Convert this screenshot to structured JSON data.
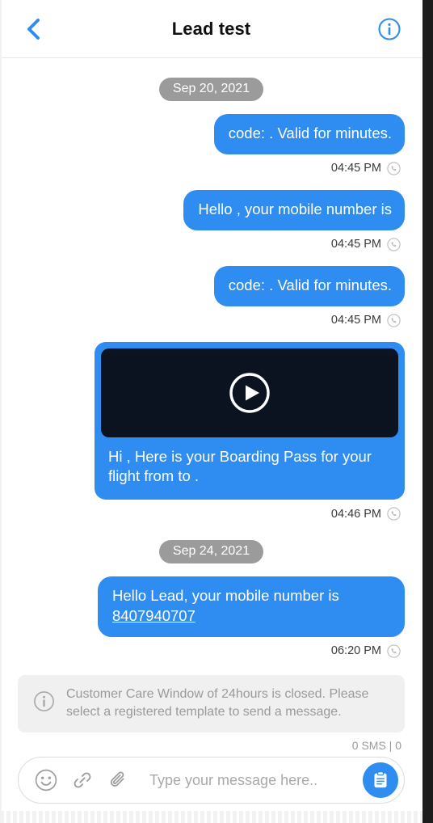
{
  "header": {
    "back_icon": "chevron-left-icon",
    "title": "Lead test",
    "info_icon": "info-circle-icon"
  },
  "colors": {
    "bubble_blue": "#2f8cf0",
    "accent": "#2f8cf0",
    "date_pill_gray": "#9b9b9b",
    "notice_bg": "#f0f0f0",
    "video_thumb": "#0b1320"
  },
  "conversation": [
    {
      "kind": "date",
      "label": "Sep 20, 2021"
    },
    {
      "kind": "text",
      "text": "code: . Valid for  minutes.",
      "time": "04:45 PM",
      "channel_icon": "whatsapp-icon"
    },
    {
      "kind": "text",
      "text": "Hello , your mobile number is",
      "time": "04:45 PM",
      "channel_icon": "whatsapp-icon"
    },
    {
      "kind": "text",
      "text": "code: . Valid for  minutes.",
      "time": "04:45 PM",
      "channel_icon": "whatsapp-icon"
    },
    {
      "kind": "video",
      "caption": "Hi  , Here is your Boarding Pass for your flight   from   to  .",
      "play_icon": "play-circle-icon",
      "time": "04:46 PM",
      "channel_icon": "whatsapp-icon"
    },
    {
      "kind": "date",
      "label": "Sep 24, 2021"
    },
    {
      "kind": "link",
      "text": "Hello Lead, your mobile number is ",
      "link_text": "8407940707",
      "time": "06:20 PM",
      "channel_icon": "whatsapp-icon"
    }
  ],
  "notice": {
    "icon": "info-circle-icon",
    "text": "Customer Care Window of 24hours is closed. Please select a registered template to send a message."
  },
  "sms_counter": "0 SMS | 0",
  "composer": {
    "emoji_icon": "smiley-icon",
    "link_icon": "link-icon",
    "attach_icon": "paperclip-icon",
    "placeholder": "Type your message here..",
    "value": "",
    "send_icon": "template-clipboard-icon"
  }
}
